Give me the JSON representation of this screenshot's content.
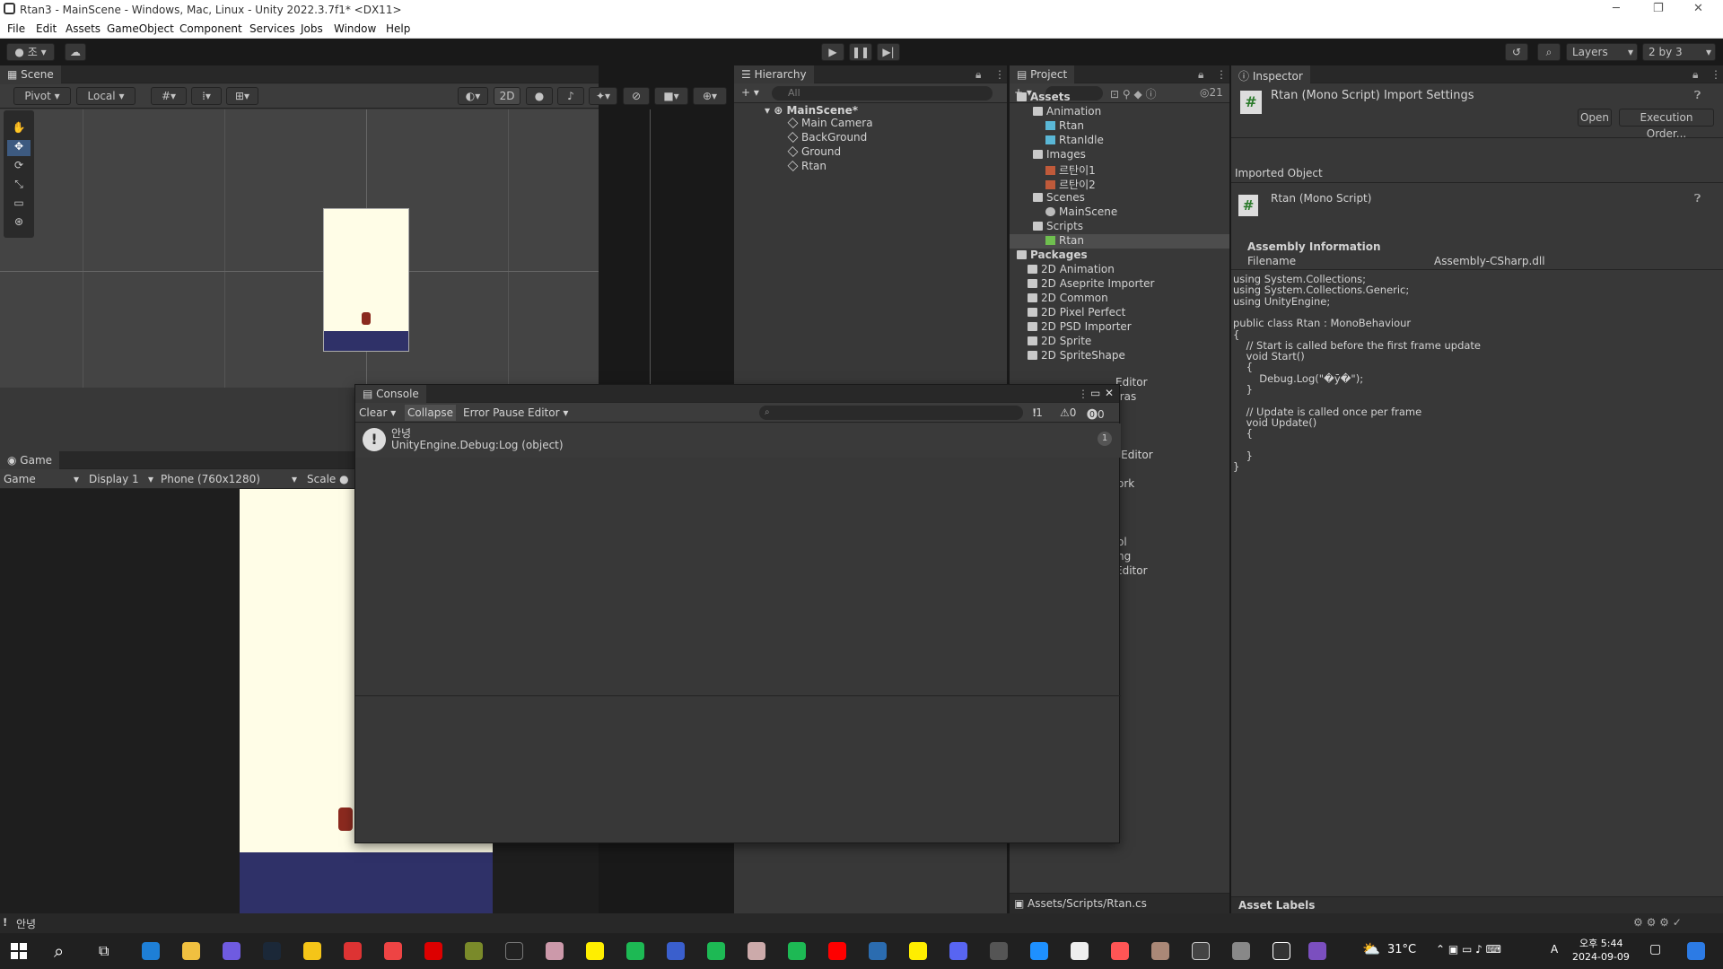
{
  "window": {
    "title": "Rtan3 - MainScene - Windows, Mac, Linux - Unity 2022.3.7f1* <DX11>"
  },
  "menu": [
    "File",
    "Edit",
    "Assets",
    "GameObject",
    "Component",
    "Services",
    "Jobs",
    "Window",
    "Help"
  ],
  "toolbar": {
    "account": "조",
    "layers": "Layers",
    "layout": "2 by 3"
  },
  "scene": {
    "tab": "Scene",
    "pivot": "Pivot",
    "local": "Local",
    "mode2d": "2D"
  },
  "game": {
    "tab": "Game",
    "view": "Game",
    "display": "Display 1",
    "resolution": "Phone (760x1280)",
    "scale": "Scale"
  },
  "hierarchy": {
    "tab": "Hierarchy",
    "search": "All",
    "scene": "MainScene*",
    "items": [
      "Main Camera",
      "BackGround",
      "Ground",
      "Rtan"
    ]
  },
  "project": {
    "tab": "Project",
    "count": "21",
    "tree": [
      {
        "label": "Assets",
        "bold": true
      },
      {
        "label": "Animation"
      },
      {
        "label": "Rtan"
      },
      {
        "label": "RtanIdle"
      },
      {
        "label": "Images"
      },
      {
        "label": "르탄이1"
      },
      {
        "label": "르탄이2"
      },
      {
        "label": "Scenes"
      },
      {
        "label": "MainScene"
      },
      {
        "label": "Scripts"
      },
      {
        "label": "Rtan",
        "selected": true
      },
      {
        "label": "Packages",
        "bold": true
      },
      {
        "label": "2D Animation"
      },
      {
        "label": "2D Aseprite Importer"
      },
      {
        "label": "2D Common"
      },
      {
        "label": "2D Pixel Perfect"
      },
      {
        "label": "2D PSD Importer"
      },
      {
        "label": "2D Sprite"
      },
      {
        "label": "2D SpriteShape"
      }
    ],
    "partial": [
      "Editor",
      "tras",
      "er Editor",
      "ork",
      "ol",
      "ng",
      "Editor"
    ],
    "path": "Assets/Scripts/Rtan.cs"
  },
  "console": {
    "tab": "Console",
    "clear": "Clear",
    "collapse": "Collapse",
    "error_pause": "Error Pause",
    "editor": "Editor",
    "info_count": "1",
    "warn_count": "0",
    "error_count": "0",
    "entry": {
      "line1": "안녕",
      "line2": "UnityEngine.Debug:Log (object)",
      "count": "1"
    }
  },
  "inspector": {
    "tab": "Inspector",
    "title": "Rtan (Mono Script) Import Settings",
    "open": "Open",
    "exec_order": "Execution Order...",
    "imported_label": "Imported Object",
    "object_name": "Rtan (Mono Script)",
    "assembly_header": "Assembly Information",
    "filename_label": "Filename",
    "filename_value": "Assembly-CSharp.dll",
    "code": [
      "using System.Collections;",
      "using System.Collections.Generic;",
      "using UnityEngine;",
      "",
      "public class Rtan : MonoBehaviour",
      "{",
      "    // Start is called before the first frame update",
      "    void Start()",
      "    {",
      "        Debug.Log(\"�ȳ�\");",
      "    }",
      "",
      "    // Update is called once per frame",
      "    void Update()",
      "    {",
      "",
      "    }",
      "}"
    ],
    "asset_labels": "Asset Labels"
  },
  "status": {
    "message": "안녕"
  },
  "taskbar": {
    "weather": "31°C",
    "ime": "A",
    "time": "오후 5:44",
    "date": "2024-09-09"
  },
  "colors": {
    "bg": "#383838",
    "dark": "#282828",
    "selection": "#2c5d87",
    "game_bg": "#fffde7",
    "ground": "#2f3168"
  }
}
